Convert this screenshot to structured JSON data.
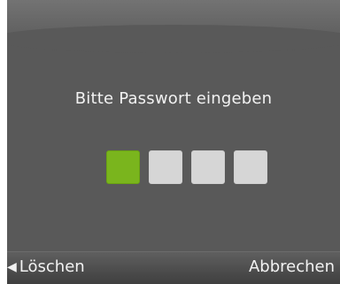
{
  "dialog": {
    "prompt": "Bitte Passwort eingeben"
  },
  "pin": {
    "length": 4,
    "entered": 1,
    "filled_color": "#7ab51d",
    "empty_color": "#d6d6d6"
  },
  "softkeys": {
    "left_arrow": "◀",
    "left_label": "Löschen",
    "right_label": "Abbrechen"
  }
}
